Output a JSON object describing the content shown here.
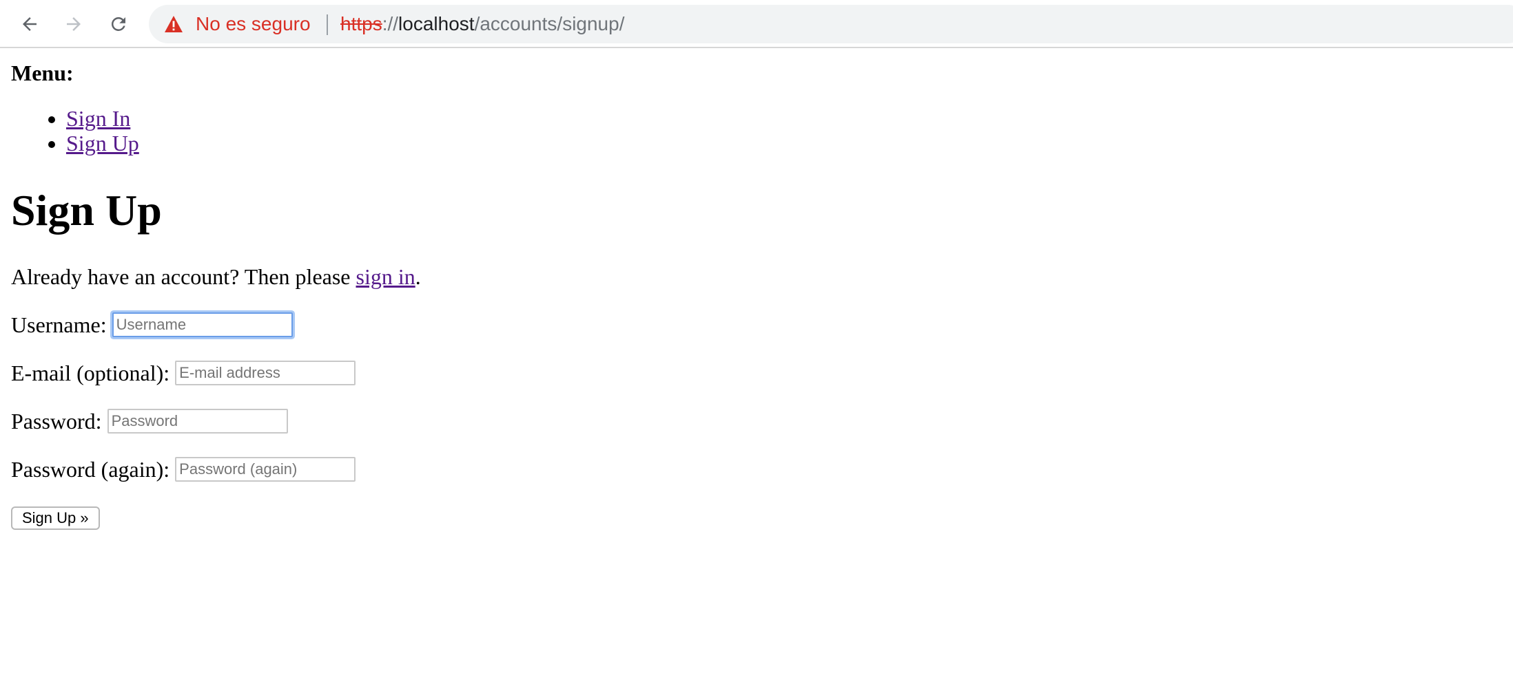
{
  "browser": {
    "security_label": "No es seguro",
    "url_scheme": "https",
    "url_separator": "://",
    "url_host": "localhost",
    "url_path": "/accounts/signup/",
    "warning_color": "#d93025"
  },
  "menu": {
    "title": "Menu:",
    "items": [
      {
        "label": "Sign In"
      },
      {
        "label": "Sign Up"
      }
    ]
  },
  "page": {
    "title": "Sign Up",
    "intro_text": "Already have an account? Then please ",
    "intro_link": "sign in",
    "intro_end": "."
  },
  "form": {
    "username": {
      "label": "Username:",
      "placeholder": "Username",
      "value": ""
    },
    "email": {
      "label": "E-mail (optional):",
      "placeholder": "E-mail address",
      "value": ""
    },
    "password": {
      "label": "Password:",
      "placeholder": "Password",
      "value": ""
    },
    "password2": {
      "label": "Password (again):",
      "placeholder": "Password (again)",
      "value": ""
    },
    "submit_label": "Sign Up »"
  }
}
